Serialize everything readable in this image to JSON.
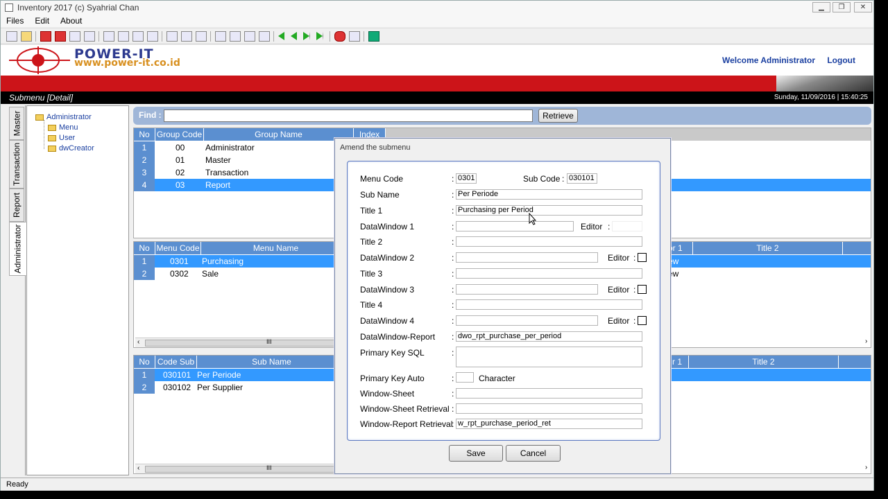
{
  "window": {
    "title": "Inventory 2017 (c) Syahrial Chan"
  },
  "menubar": [
    "Files",
    "Edit",
    "About"
  ],
  "header": {
    "brand_title": "POWER-IT",
    "brand_url": "www.power-it.co.id",
    "welcome": "Welcome  Administrator",
    "logout": "Logout"
  },
  "subheader": {
    "title": "Submenu [Detail]",
    "datetime": "Sunday,  11/09/2016 | 15:40:25"
  },
  "vtabs": [
    "Master",
    "Transaction",
    "Report",
    "Administrator"
  ],
  "tree": {
    "root": "Administrator",
    "children": [
      "Menu",
      "User",
      "dwCreator"
    ]
  },
  "find": {
    "label": "Find :",
    "value": "",
    "retrieve_label": "Retrieve"
  },
  "group_grid": {
    "headers": [
      "No",
      "Group Code",
      "Group Name",
      "Index"
    ],
    "rows": [
      {
        "no": "1",
        "code": "00",
        "name": "Administrator"
      },
      {
        "no": "2",
        "code": "01",
        "name": "Master"
      },
      {
        "no": "3",
        "code": "02",
        "name": "Transaction"
      },
      {
        "no": "4",
        "code": "03",
        "name": "Report"
      }
    ]
  },
  "menu_grid": {
    "headers": [
      "No",
      "Menu Code",
      "Menu Name",
      "or 1",
      "Title 2"
    ],
    "rows": [
      {
        "no": "1",
        "code": "0301",
        "name": "Purchasing",
        "extra": "ew"
      },
      {
        "no": "2",
        "code": "0302",
        "name": "Sale",
        "extra": "ew"
      }
    ]
  },
  "sub_grid": {
    "headers": [
      "No",
      "Code Sub",
      "Sub Name",
      "r 1",
      "Title 2"
    ],
    "rows": [
      {
        "no": "1",
        "code": "030101",
        "name": "Per Periode"
      },
      {
        "no": "2",
        "code": "030102",
        "name": "Per Supplier"
      }
    ]
  },
  "scroll": {
    "glyph": "III",
    "left": "‹",
    "right": "›"
  },
  "dialog": {
    "title": "Amend the submenu",
    "labels": {
      "menu_code": "Menu Code",
      "sub_code": "Sub Code",
      "sub_name": "Sub Name",
      "title1": "Title 1",
      "dw1": "DataWindow 1",
      "editor": "Editor",
      "title2": "Title 2",
      "dw2": "DataWindow 2",
      "title3": "Title 3",
      "dw3": "DataWindow 3",
      "title4": "Title 4",
      "dw4": "DataWindow 4",
      "dw_report": "DataWindow-Report",
      "pk_sql": "Primary Key SQL",
      "pk_auto": "Primary Key Auto",
      "character": "Character",
      "window_sheet": "Window-Sheet",
      "ws_retrieval": "Window-Sheet Retrieval",
      "wr_retrieval": "Window-Report Retrieval"
    },
    "values": {
      "menu_code": "0301",
      "sub_code": "030101",
      "sub_name": "Per Periode",
      "title1": "Purchasing per Period",
      "dw1": "",
      "editor1": "",
      "title2": "",
      "dw2": "",
      "title3": "",
      "dw3": "",
      "title4": "",
      "dw4": "",
      "dw_report": "dwo_rpt_purchase_per_period",
      "pk_sql": "",
      "pk_auto": "",
      "window_sheet": "",
      "ws_retrieval": "",
      "wr_retrieval": "w_rpt_purchase_period_ret"
    },
    "save_label": "Save",
    "cancel_label": "Cancel"
  },
  "status": {
    "text": "Ready"
  }
}
